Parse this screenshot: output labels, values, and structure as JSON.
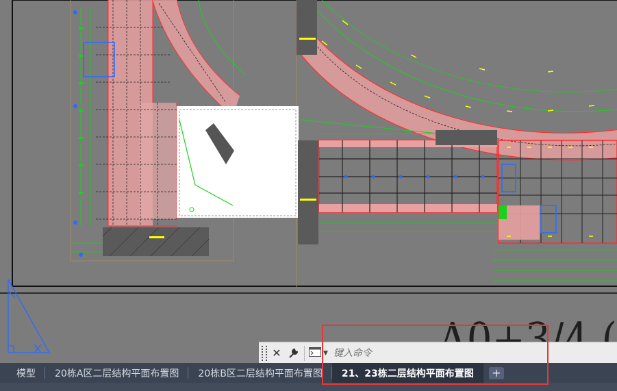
{
  "canvas": {
    "titleblock_text": "A0+3/4 (",
    "colors": {
      "background": "#7c7c7c",
      "red": "#ff2d2d",
      "yellow": "#ffff00",
      "green": "#19d219",
      "blue": "#2a6bff",
      "pink": "#e8a0a0"
    }
  },
  "command_line": {
    "close_icon": "close-icon",
    "settings_icon": "wrench-icon",
    "prompt_icon": "command-prompt-icon",
    "placeholder": "键入命令"
  },
  "layout_tabs": {
    "tabs": [
      {
        "label": "模型",
        "active": false
      },
      {
        "label": "20栋A区二层结构平面布置图",
        "active": false
      },
      {
        "label": "20栋B区二层结构平面布置图",
        "active": false
      },
      {
        "label": "21、23栋二层结构平面布置图",
        "active": true
      }
    ],
    "add_icon": "plus-icon",
    "add_label": "+"
  }
}
